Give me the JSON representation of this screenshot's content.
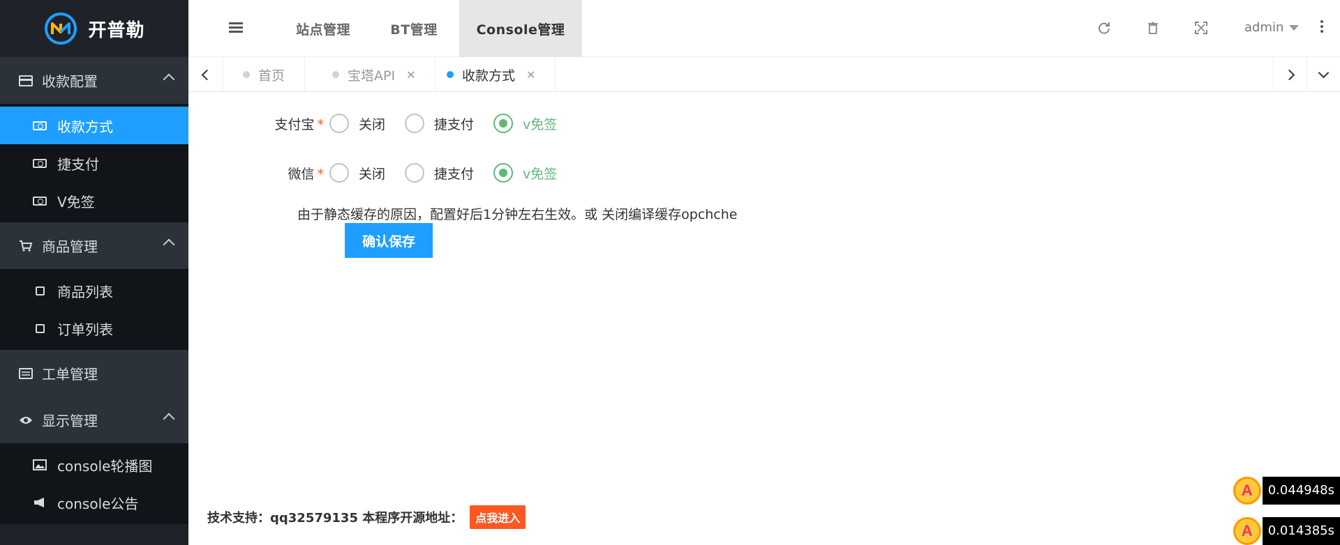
{
  "app": {
    "logo_text": "开普勒"
  },
  "sidebar": {
    "groups": [
      {
        "label": "收款配置",
        "items": [
          {
            "label": "收款方式"
          },
          {
            "label": "捷支付"
          },
          {
            "label": "V免签"
          }
        ]
      },
      {
        "label": "商品管理",
        "items": [
          {
            "label": "商品列表"
          },
          {
            "label": "订单列表"
          }
        ]
      },
      {
        "label": "工单管理",
        "items": []
      },
      {
        "label": "显示管理",
        "items": [
          {
            "label": "console轮播图"
          },
          {
            "label": "console公告"
          }
        ]
      }
    ],
    "active_item": "收款方式"
  },
  "header": {
    "tabs": [
      {
        "label": "站点管理"
      },
      {
        "label": "BT管理"
      },
      {
        "label": "Console管理"
      }
    ],
    "active_tab": "Console管理",
    "user": "admin"
  },
  "tabbar": {
    "tabs": [
      {
        "label": "首页"
      },
      {
        "label": "宝塔API"
      },
      {
        "label": "收款方式"
      }
    ],
    "active_tab": "收款方式"
  },
  "form": {
    "rows": [
      {
        "label": "支付宝",
        "options": [
          "关闭",
          "捷支付",
          "v免签"
        ],
        "selected": "v免签"
      },
      {
        "label": "微信",
        "options": [
          "关闭",
          "捷支付",
          "v免签"
        ],
        "selected": "v免签"
      }
    ],
    "required_mark": "*",
    "note": "由于静态缓存的原因，配置好后1分钟左右生效。或 关闭编译缓存opchche",
    "submit_label": "确认保存"
  },
  "footer": {
    "text": "技术支持：qq32579135  本程序开源地址：",
    "link_label": "点我进入"
  },
  "timers": [
    {
      "value": "0.044948s"
    },
    {
      "value": "0.014385s"
    }
  ],
  "colors": {
    "accent": "#1e9fff",
    "sidebar_bg": "#20222a",
    "checked": "#5fb878",
    "badge": "#ff5722"
  }
}
